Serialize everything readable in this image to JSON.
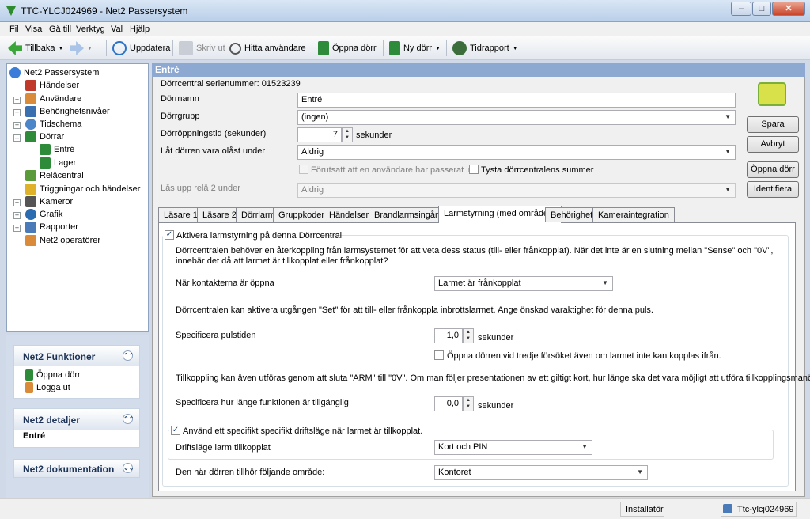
{
  "window": {
    "title": "TTC-YLCJ024969 - Net2 Passersystem"
  },
  "menu": [
    "Fil",
    "Visa",
    "Gå till",
    "Verktyg",
    "Val",
    "Hjälp"
  ],
  "toolbar": {
    "back": "Tillbaka",
    "refresh": "Uppdatera",
    "print": "Skriv ut",
    "find_user": "Hitta användare",
    "open_door": "Öppna dörr",
    "new_door": "Ny dörr",
    "time_report": "Tidrapport"
  },
  "tree": {
    "root": "Net2 Passersystem",
    "items": [
      "Händelser",
      "Användare",
      "Behörighetsnivåer",
      "Tidschema",
      "Dörrar",
      "Entré",
      "Lager",
      "Reläcentral",
      "Triggningar och händelser",
      "Kameror",
      "Grafik",
      "Rapporter",
      "Net2 operatörer"
    ]
  },
  "panels": {
    "functions_title": "Net2 Funktioner",
    "functions": [
      "Öppna dörr",
      "Logga ut"
    ],
    "details_title": "Net2 detaljer",
    "details_value": "Entré",
    "docs_title": "Net2 dokumentation"
  },
  "main": {
    "heading": "Entré",
    "serial": "Dörrcentral serienummer: 01523239",
    "door_name_label": "Dörrnamn",
    "door_name_value": "Entré",
    "door_group_label": "Dörrgrupp",
    "door_group_value": "(ingen)",
    "open_time_label": "Dörröppningstid (sekunder)",
    "open_time_value": "7",
    "open_time_unit": "sekunder",
    "unlocked_label": "Låt dörren vara olåst under",
    "unlocked_value": "Aldrig",
    "provided_label": "Förutsatt att en användare har passerat in",
    "silence_label": "Tysta dörrcentralens summer",
    "relay2_label": "Lås upp relä 2 under",
    "relay2_value": "Aldrig",
    "buttons": {
      "save": "Spara",
      "cancel": "Avbryt",
      "open": "Öppna dörr",
      "identify": "Identifiera"
    }
  },
  "tabs": [
    "Läsare 1",
    "Läsare 2",
    "Dörrlarm",
    "Gruppkoder",
    "Händelser",
    "Brandlarmsingång",
    "Larmstyrning (med områden)",
    "Behörighet",
    "Kameraintegration"
  ],
  "alarm": {
    "enable_label": "Aktivera larmstyrning på denna Dörrcentral",
    "enable_checked": true,
    "desc1": "Dörrcentralen behöver en återkoppling från larmsystemet för att veta dess status (till- eller frånkopplat). När det inte är en slutning mellan \"Sense\" och \"0V\", innebär det då att larmet är tillkopplat eller frånkopplat?",
    "contacts_label": "När kontakterna är öppna",
    "contacts_value": "Larmet är frånkopplat",
    "desc2": "Dörrcentralen kan aktivera utgången \"Set\" för att till- eller frånkoppla inbrottslarmet. Ange önskad varaktighet för denna puls.",
    "pulse_label": "Specificera pulstiden",
    "pulse_value": "1,0",
    "pulse_unit": "sekunder",
    "third_try_label": "Öppna dörren vid tredje försöket även om larmet inte kan kopplas ifrån.",
    "desc3": "Tillkoppling kan även utföras genom att sluta \"ARM\" till \"0V\". Om man följer presentationen av ett giltigt kort, hur länge ska det vara möjligt att utföra tillkopplingsmanövrer?",
    "avail_label": "Specificera hur länge funktionen är tillgänglig",
    "avail_value": "0,0",
    "avail_unit": "sekunder",
    "specific_mode_label": "Använd ett specifikt specifikt driftsläge när larmet är tillkopplat.",
    "specific_mode_checked": true,
    "mode_label": "Driftsläge larm tillkopplat",
    "mode_value": "Kort och PIN",
    "area_label": "Den här dörren tillhör följande område:",
    "area_value": "Kontoret"
  },
  "status": {
    "role": "Installatör",
    "host": "Ttc-ylcj024969"
  }
}
